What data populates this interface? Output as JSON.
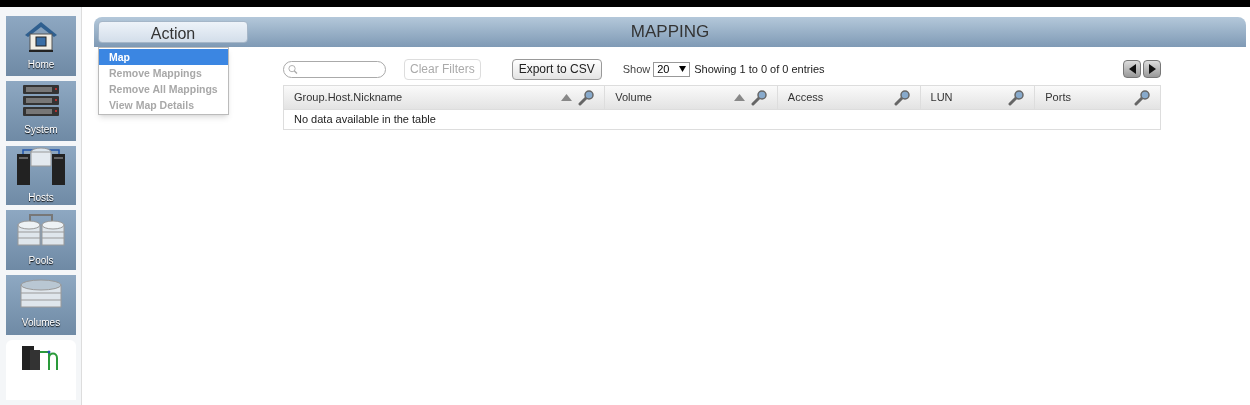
{
  "sidebar": {
    "items": [
      {
        "kind": "home",
        "label": "Home",
        "selected": false
      },
      {
        "kind": "system",
        "label": "System",
        "selected": false
      },
      {
        "kind": "hosts",
        "label": "Hosts",
        "selected": false
      },
      {
        "kind": "pools",
        "label": "Pools",
        "selected": false
      },
      {
        "kind": "volumes",
        "label": "Volumes",
        "selected": false
      },
      {
        "kind": "mapping",
        "selected": true
      }
    ]
  },
  "header": {
    "action_button": "Action",
    "title": "MAPPING"
  },
  "action_menu": [
    {
      "label": "Map",
      "selected": true,
      "disabled": false
    },
    {
      "label": "Remove Mappings",
      "selected": false,
      "disabled": true
    },
    {
      "label": "Remove All Mappings",
      "selected": false,
      "disabled": true
    },
    {
      "label": "View Map Details",
      "selected": false,
      "disabled": true
    }
  ],
  "toolbar": {
    "clear_filters": "Clear Filters",
    "clear_filters_disabled": true,
    "export": "Export to CSV",
    "show_label": "Show",
    "page_size": "20",
    "info": "Showing 1 to 0 of 0 entries"
  },
  "table": {
    "columns": [
      {
        "label": "Group.Host.Nickname",
        "sortable": true
      },
      {
        "label": "Volume",
        "sortable": true
      },
      {
        "label": "Access",
        "sortable": false
      },
      {
        "label": "LUN",
        "sortable": false
      },
      {
        "label": "Ports",
        "sortable": false
      }
    ],
    "empty_message": "No data available in the table"
  }
}
